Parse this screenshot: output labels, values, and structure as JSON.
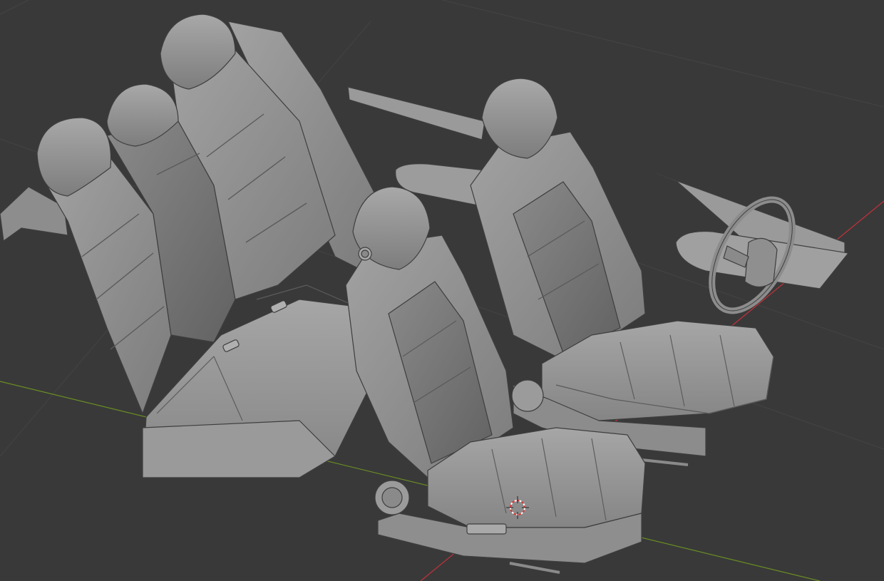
{
  "viewport": {
    "background": "#393939",
    "grid_color": "#444444",
    "x_axis_color": "#c3323a",
    "y_axis_color": "#6a8e23",
    "model_color": "#8f8f8f"
  },
  "scene": {
    "objects": [
      {
        "name": "rear-bench-seat",
        "type": "mesh"
      },
      {
        "name": "driver-seat",
        "type": "mesh"
      },
      {
        "name": "passenger-seat",
        "type": "mesh"
      },
      {
        "name": "steering-wheel",
        "type": "mesh"
      },
      {
        "name": "door-armrest-left",
        "type": "mesh"
      },
      {
        "name": "door-armrest-right",
        "type": "mesh"
      }
    ],
    "cursor_icon": "3d-cursor-icon"
  }
}
